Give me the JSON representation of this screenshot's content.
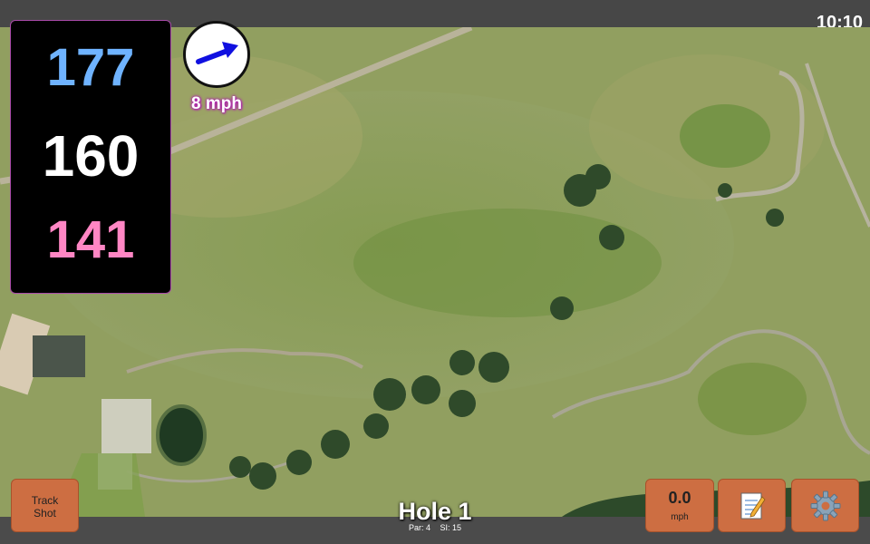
{
  "status": {
    "time": "10:10"
  },
  "distances": {
    "back": "177",
    "middle": "160",
    "front": "141"
  },
  "colors": {
    "back": "#6fb3ff",
    "middle": "#ffffff",
    "front": "#ff86c4",
    "button": "#cd6e42",
    "wind_arrow": "#1010e0"
  },
  "wind": {
    "speed": "8 mph",
    "direction_icon": "arrow-icon"
  },
  "hole": {
    "title": "Hole 1",
    "par": "Par: 4",
    "si": "SI: 15"
  },
  "buttons": {
    "track_shot": {
      "label_line1": "Track",
      "label_line2": "Shot"
    },
    "speed": {
      "value": "0.0",
      "unit": "mph"
    },
    "notes_icon": "memo-icon",
    "settings_icon": "gear-icon"
  }
}
